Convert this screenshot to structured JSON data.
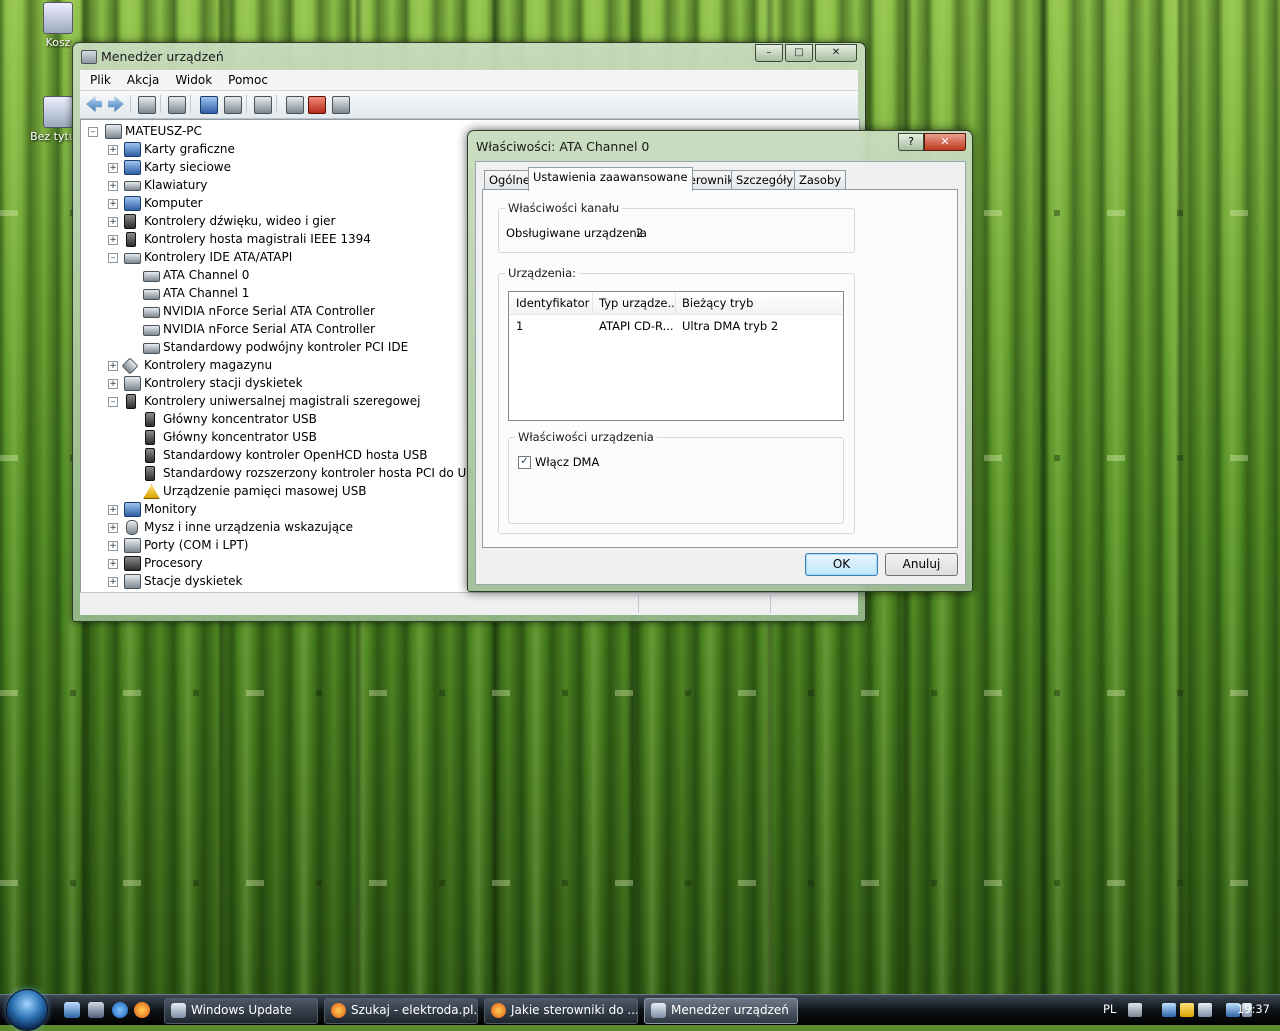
{
  "desktop": {
    "icons": [
      {
        "label": "Kosz"
      },
      {
        "label": "Bez tytułu"
      }
    ]
  },
  "devmgr": {
    "title": "Menedżer urządzeń",
    "caption": {
      "minimize": "–",
      "maximize": "□",
      "close": "✕"
    },
    "menu": [
      "Plik",
      "Akcja",
      "Widok",
      "Pomoc"
    ],
    "tree": [
      {
        "label": "MATEUSZ-PC",
        "expander": "–"
      },
      {
        "label": "Karty graficzne",
        "expander": "+"
      },
      {
        "label": "Karty sieciowe",
        "expander": "+"
      },
      {
        "label": "Klawiatury",
        "expander": "+"
      },
      {
        "label": "Komputer",
        "expander": "+"
      },
      {
        "label": "Kontrolery dźwięku, wideo i gier",
        "expander": "+"
      },
      {
        "label": "Kontrolery hosta magistrali IEEE 1394",
        "expander": "+"
      },
      {
        "label": "Kontrolery IDE ATA/ATAPI",
        "expander": "–"
      },
      {
        "label": "ATA Channel 0"
      },
      {
        "label": "ATA Channel 1"
      },
      {
        "label": "NVIDIA nForce Serial ATA Controller"
      },
      {
        "label": "NVIDIA nForce Serial ATA Controller"
      },
      {
        "label": "Standardowy podwójny kontroler PCI IDE"
      },
      {
        "label": "Kontrolery magazynu",
        "expander": "+"
      },
      {
        "label": "Kontrolery stacji dyskietek",
        "expander": "+"
      },
      {
        "label": "Kontrolery uniwersalnej magistrali szeregowej",
        "expander": "–"
      },
      {
        "label": "Główny koncentrator USB"
      },
      {
        "label": "Główny koncentrator USB"
      },
      {
        "label": "Standardowy kontroler OpenHCD hosta USB"
      },
      {
        "label": "Standardowy rozszerzony kontroler hosta PCI do USB"
      },
      {
        "label": "Urządzenie pamięci masowej USB"
      },
      {
        "label": "Monitory",
        "expander": "+"
      },
      {
        "label": "Mysz i inne urządzenia wskazujące",
        "expander": "+"
      },
      {
        "label": "Porty (COM i LPT)",
        "expander": "+"
      },
      {
        "label": "Procesory",
        "expander": "+"
      },
      {
        "label": "Stacje dyskietek",
        "expander": "+"
      }
    ]
  },
  "props": {
    "title": "Właściwości: ATA Channel 0",
    "help": "?",
    "close": "✕",
    "tabs": [
      "Ogólne",
      "Ustawienia zaawansowane",
      "Sterownik",
      "Szczegóły",
      "Zasoby"
    ],
    "channel_group": {
      "title": "Właściwości kanału",
      "supported_label": "Obsługiwane urządzenia",
      "supported_value": "2"
    },
    "devices_group": {
      "title": "Urządzenia:",
      "columns": [
        "Identyfikator ...",
        "Typ urządze...",
        "Bieżący tryb"
      ],
      "rows": [
        [
          "1",
          "ATAPI CD-R...",
          "Ultra DMA tryb 2"
        ]
      ]
    },
    "device_props": {
      "title": "Właściwości urządzenia",
      "dma_label": "Włącz DMA",
      "dma_checked": "✓"
    },
    "ok": "OK",
    "cancel": "Anuluj"
  },
  "taskbar": {
    "buttons": [
      {
        "label": "Windows Update"
      },
      {
        "label": "Szukaj - elektroda.pl..."
      },
      {
        "label": "Jakie sterowniki do ..."
      },
      {
        "label": "Menedżer urządzeń"
      }
    ],
    "language": "PL",
    "clock": "19:37"
  }
}
